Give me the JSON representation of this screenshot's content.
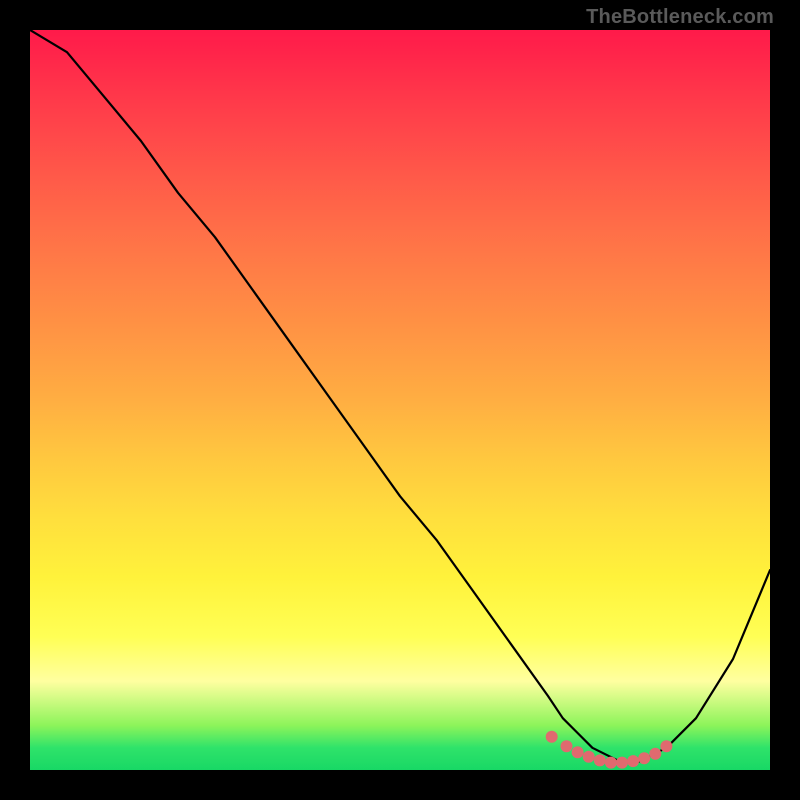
{
  "watermark": "TheBottleneck.com",
  "chart_data": {
    "type": "line",
    "title": "",
    "xlabel": "",
    "ylabel": "",
    "xlim": [
      0,
      100
    ],
    "ylim": [
      0,
      100
    ],
    "grid": false,
    "legend": false,
    "series": [
      {
        "name": "curve",
        "x": [
          0,
          5,
          10,
          15,
          20,
          25,
          30,
          35,
          40,
          45,
          50,
          55,
          60,
          65,
          70,
          72,
          74,
          76,
          78,
          80,
          82,
          84,
          86,
          90,
          95,
          100
        ],
        "y": [
          100,
          97,
          91,
          85,
          78,
          72,
          65,
          58,
          51,
          44,
          37,
          31,
          24,
          17,
          10,
          7,
          5,
          3,
          2,
          1,
          1,
          2,
          3,
          7,
          15,
          27
        ]
      }
    ],
    "markers": {
      "name": "highlight-dots",
      "x": [
        70.5,
        72.5,
        74,
        75.5,
        77,
        78.5,
        80,
        81.5,
        83,
        84.5,
        86
      ],
      "y": [
        4.5,
        3.2,
        2.4,
        1.8,
        1.3,
        1.0,
        1.0,
        1.2,
        1.6,
        2.2,
        3.2
      ]
    },
    "background_gradient": {
      "top": "#ff1a4a",
      "mid": "#ffff55",
      "bottom": "#18d865"
    }
  }
}
